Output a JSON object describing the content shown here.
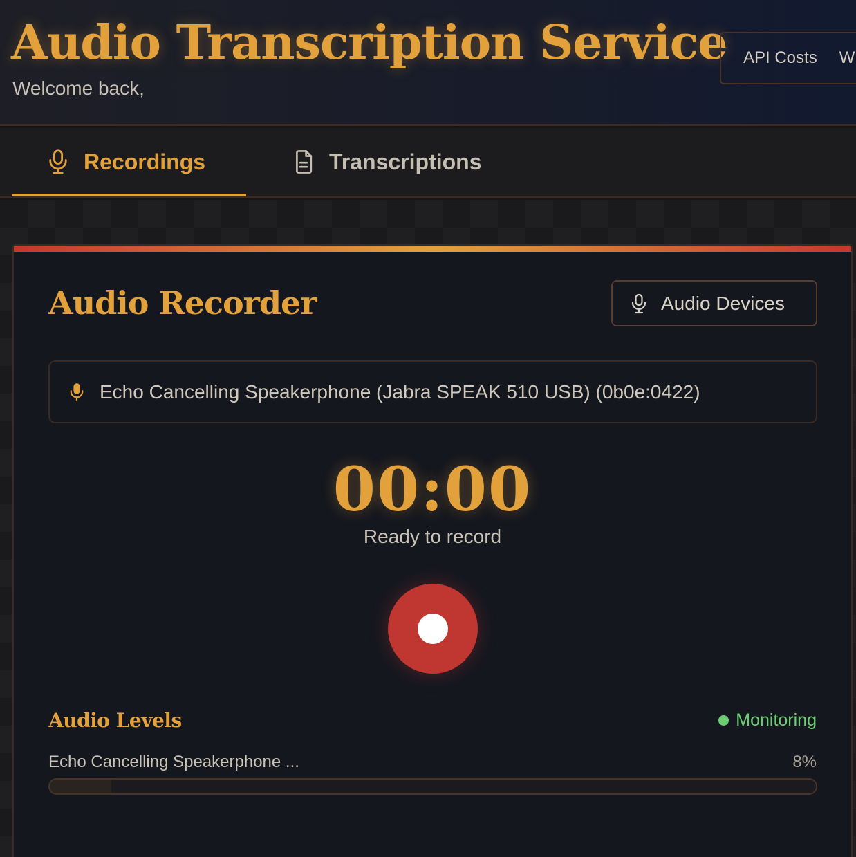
{
  "header": {
    "title": "Audio Transcription Service",
    "welcome": "Welcome back,",
    "nav": [
      "API Costs",
      "W"
    ]
  },
  "tabs": [
    {
      "label": "Recordings",
      "icon": "microphone-icon",
      "active": true
    },
    {
      "label": "Transcriptions",
      "icon": "document-icon",
      "active": false
    }
  ],
  "recorder": {
    "title": "Audio Recorder",
    "devices_button": "Audio Devices",
    "selected_device": "Echo Cancelling Speakerphone (Jabra SPEAK 510 USB) (0b0e:0422)",
    "timer": "00:00",
    "status": "Ready to record"
  },
  "levels": {
    "title": "Audio Levels",
    "monitoring": "Monitoring",
    "device_name": "Echo Cancelling Speakerphone ...",
    "percent_label": "8%",
    "level_fraction": 0.08
  },
  "colors": {
    "accent": "#e3a13c",
    "record": "#c03630",
    "monitoring": "#6bcf72"
  }
}
